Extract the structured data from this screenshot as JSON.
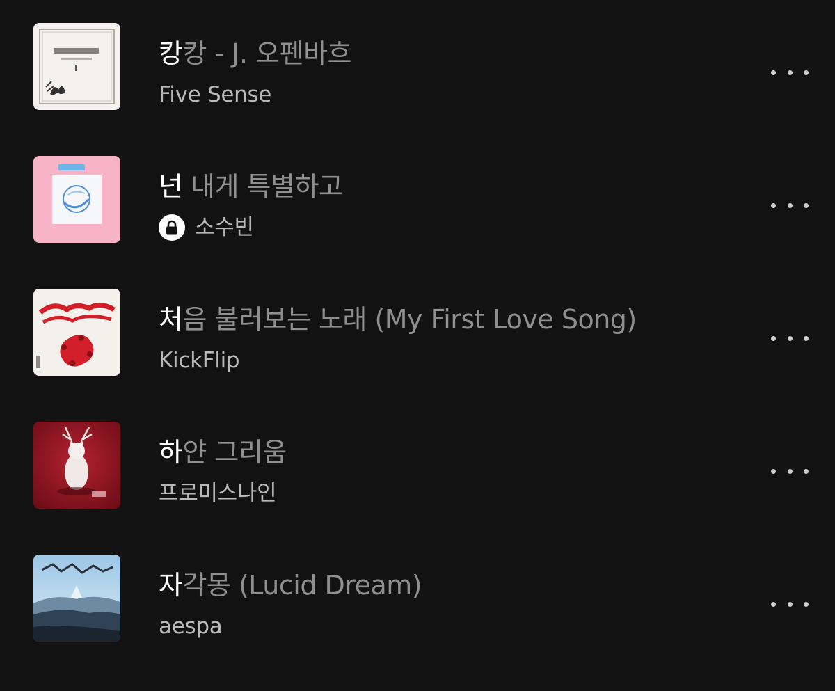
{
  "tracks": [
    {
      "title_typed": "캉",
      "title_rest": "캉 - J. 오펜바흐",
      "artist": "Five Sense",
      "locked": false,
      "cover_icon": "classical-album-cover"
    },
    {
      "title_typed": "넌",
      "title_rest": " 내게 특별하고",
      "artist": "소수빈",
      "locked": true,
      "cover_icon": "pink-album-cover"
    },
    {
      "title_typed": "처",
      "title_rest": "음 불러보는 노래 (My First Love Song)",
      "artist": "KickFlip",
      "locked": false,
      "cover_icon": "red-skateboard-album-cover"
    },
    {
      "title_typed": "하",
      "title_rest": "얀 그리움",
      "artist": "프로미스나인",
      "locked": false,
      "cover_icon": "red-cat-album-cover"
    },
    {
      "title_typed": "자",
      "title_rest": "각몽 (Lucid Dream)",
      "artist": "aespa",
      "locked": false,
      "cover_icon": "blue-landscape-album-cover"
    }
  ],
  "colors": {
    "background": "#121212",
    "typed_text": "#ffffff",
    "rest_text": "#8f8f8f",
    "artist_text": "#b9b9b9"
  },
  "icons": {
    "lock": "lock-icon",
    "more": "more-options-icon"
  }
}
